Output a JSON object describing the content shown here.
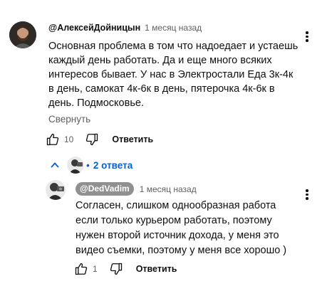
{
  "comment": {
    "author": "@АлексейДойницын",
    "time": "1 месяц назад",
    "lines": [
      "Основная проблема в том что надоедает и устаешь",
      "каждый день работать. Да и еще много всяких",
      "интересов бывает. У нас в Электростали Еда 3к-4к",
      "в день, самокат 4к-6к в день, пятерочка 4к-6к в",
      "день. Подмосковье."
    ],
    "collapse_label": "Свернуть",
    "likes": "10",
    "reply_label": "Ответить"
  },
  "replies": {
    "count_label": "2 ответа"
  },
  "reply": {
    "author": "@DedVadim",
    "time": "1 месяц назад",
    "lines": [
      "Согласен, слишком однообразная работа",
      "если только курьером работать, поэтому",
      "нужен второй источник дохода, у меня это",
      "видео съемки, поэтому у меня все хорошо )"
    ],
    "likes": "1",
    "reply_label": "Ответить"
  },
  "colors": {
    "link_blue": "#065fd4",
    "secondary_text": "#606060",
    "badge_gray": "#909090"
  },
  "icons": [
    "like-icon",
    "dislike-icon",
    "chevron-up-icon",
    "more-vert-icon"
  ]
}
